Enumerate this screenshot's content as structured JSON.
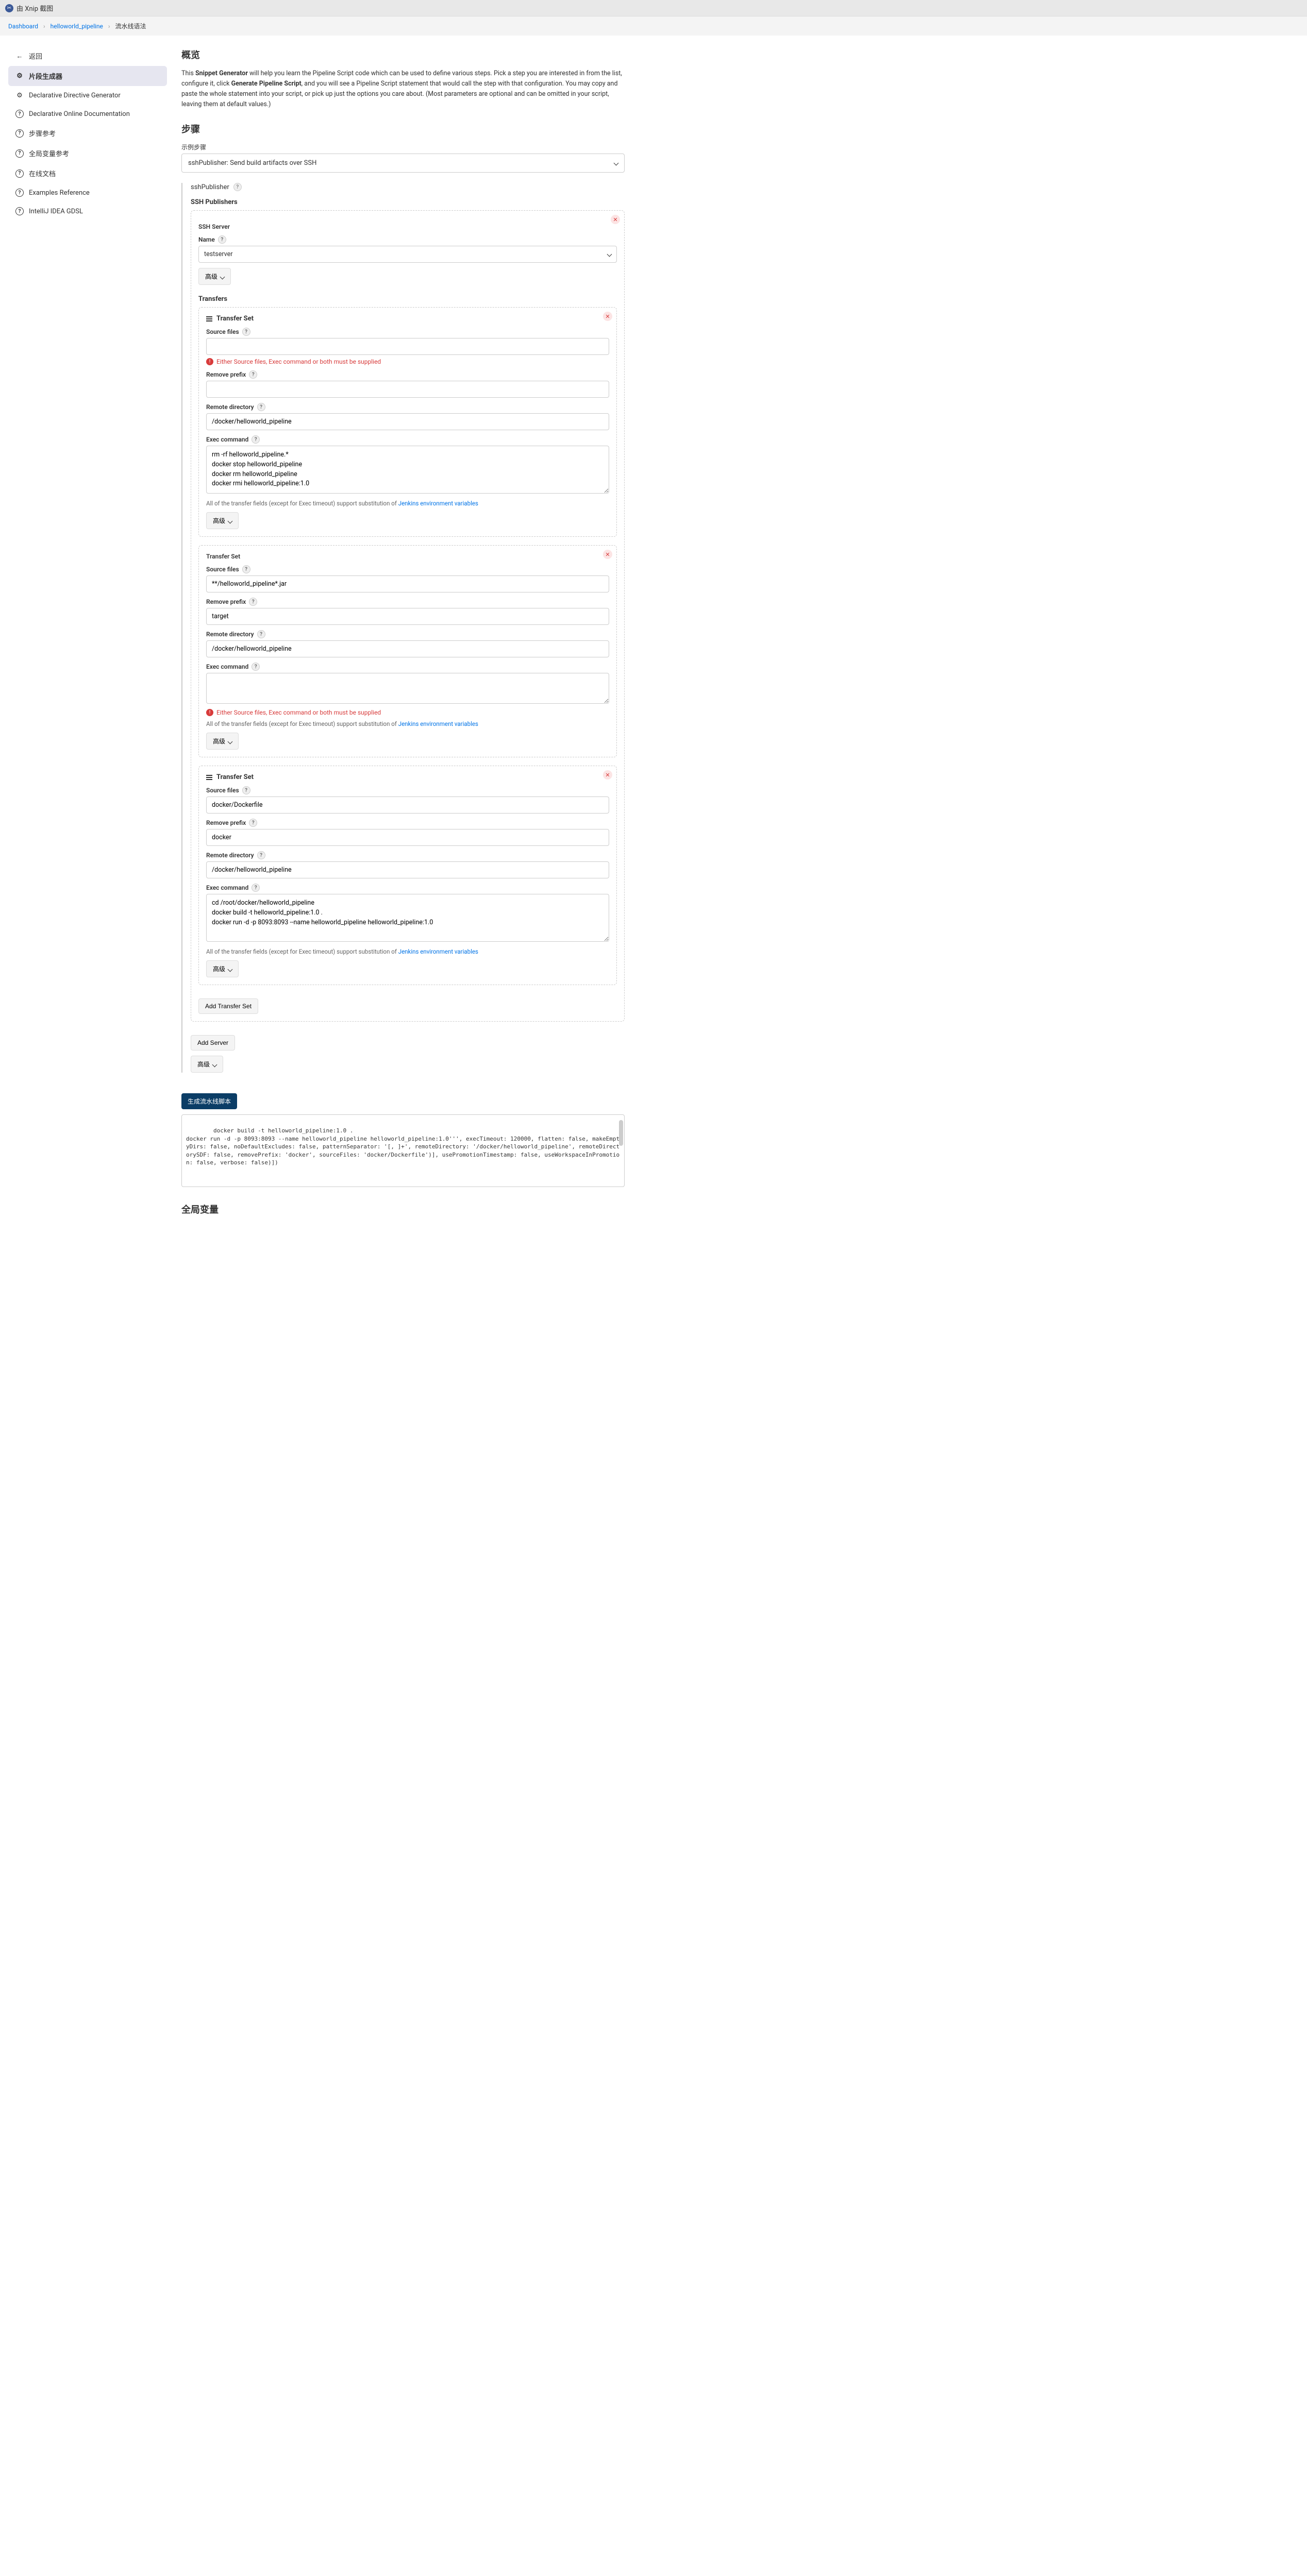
{
  "titlebar": "由 Xnip 截图",
  "breadcrumb": [
    "Dashboard",
    "helloworld_pipeline",
    "流水线语法"
  ],
  "sidebar": {
    "back": "返回",
    "items": [
      "片段生成器",
      "Declarative Directive Generator",
      "Declarative Online Documentation",
      "步骤参考",
      "全局变量参考",
      "在线文档",
      "Examples Reference",
      "IntelliJ IDEA GDSL"
    ]
  },
  "overview": {
    "title": "概览",
    "p1a": "This ",
    "p1b": "Snippet Generator",
    "p1c": " will help you learn the Pipeline Script code which can be used to define various steps. Pick a step you are interested in from the list, configure it, click ",
    "p1d": "Generate Pipeline Script",
    "p1e": ", and you will see a Pipeline Script statement that would call the step with that configuration. You may copy and paste the whole statement into your script, or pick up just the options you care about. (Most parameters are optional and can be omitted in your script, leaving them at default values.)"
  },
  "steps": {
    "title": "步骤",
    "sample_label": "示例步骤",
    "selected": "sshPublisher: Send build artifacts over SSH",
    "step_name": "sshPublisher",
    "publishers_title": "SSH Publishers"
  },
  "server": {
    "ssh_server_label": "SSH Server",
    "name_label": "Name",
    "name_value": "testserver",
    "advanced": "高级",
    "transfers_title": "Transfers"
  },
  "ts": {
    "header": "Transfer Set",
    "source_label": "Source files",
    "remove_prefix_label": "Remove prefix",
    "remote_dir_label": "Remote directory",
    "exec_label": "Exec command",
    "err": "Either Source files, Exec command or both must be supplied",
    "info_a": "All of the transfer fields (except for Exec timeout) support substitution of ",
    "info_link": "Jenkins environment variables",
    "advanced": "高级"
  },
  "ts1": {
    "source": "",
    "prefix": "",
    "remote": "/docker/helloworld_pipeline",
    "exec": "rm -rf helloworld_pipeline.*\ndocker stop helloworld_pipeline\ndocker rm helloworld_pipeline\ndocker rmi helloworld_pipeline:1.0"
  },
  "ts2": {
    "source": "**/helloworld_pipeline*.jar",
    "prefix": "target",
    "remote": "/docker/helloworld_pipeline",
    "exec": ""
  },
  "ts3": {
    "source": "docker/Dockerfile",
    "prefix": "docker",
    "remote": "/docker/helloworld_pipeline",
    "exec": "cd /root/docker/helloworld_pipeline\ndocker build -t helloworld_pipeline:1.0 .\ndocker run -d -p 8093:8093 --name helloworld_pipeline helloworld_pipeline:1.0"
  },
  "buttons": {
    "add_transfer": "Add Transfer Set",
    "add_server": "Add Server",
    "advanced": "高级",
    "generate": "生成流水线脚本"
  },
  "output": "docker build -t helloworld_pipeline:1.0 .\ndocker run -d -p 8093:8093 --name helloworld_pipeline helloworld_pipeline:1.0''', execTimeout: 120000, flatten: false, makeEmptyDirs: false, noDefaultExcludes: false, patternSeparator: '[, ]+', remoteDirectory: '/docker/helloworld_pipeline', remoteDirectorySDF: false, removePrefix: 'docker', sourceFiles: 'docker/Dockerfile')], usePromotionTimestamp: false, useWorkspaceInPromotion: false, verbose: false)])",
  "globals": {
    "title": "全局变量"
  }
}
